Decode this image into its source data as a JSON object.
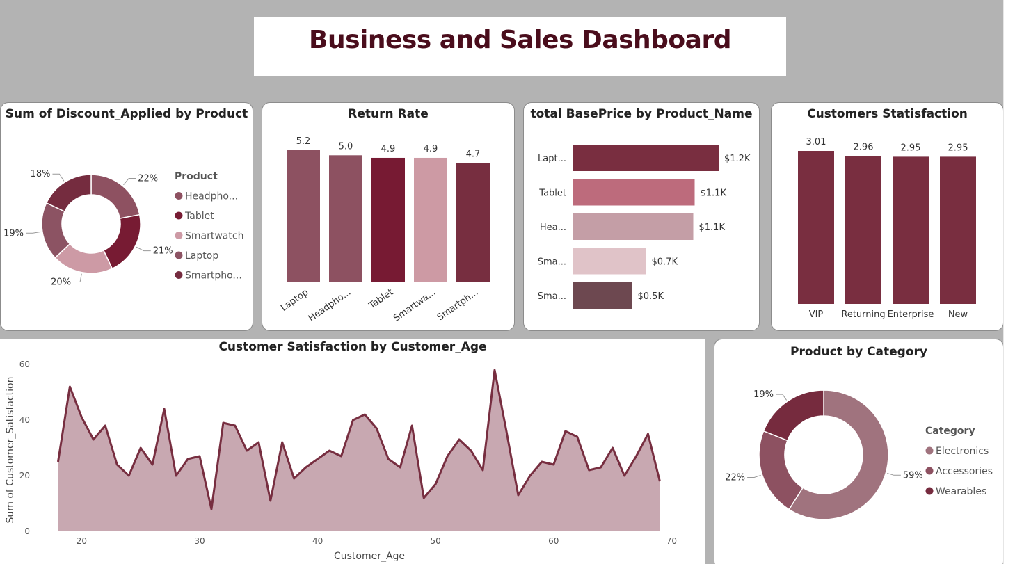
{
  "dashboard_title": "Business and Sales Dashboard",
  "chart_data": [
    {
      "id": "discount",
      "type": "pie",
      "title": "Sum of Discount_Applied by Product",
      "legend_title": "Product",
      "legend_position": "right",
      "slices": [
        {
          "label": "Headpho...",
          "pct_label": "22%",
          "value": 22,
          "color": "#8e5161"
        },
        {
          "label": "Tablet",
          "pct_label": "21%",
          "value": 21,
          "color": "#771b33"
        },
        {
          "label": "Smartwatch",
          "pct_label": "20%",
          "value": 20,
          "color": "#cd9aa5"
        },
        {
          "label": "Laptop",
          "pct_label": "19%",
          "value": 19,
          "color": "#8c5363"
        },
        {
          "label": "Smartpho...",
          "pct_label": "18%",
          "value": 18,
          "color": "#752c3f"
        }
      ]
    },
    {
      "id": "return_rate",
      "type": "bar",
      "title": "Return Rate",
      "categories": [
        "Laptop",
        "Headpho...",
        "Tablet",
        "Smartwa...",
        "Smartph..."
      ],
      "values": [
        5.2,
        5.0,
        4.9,
        4.9,
        4.7
      ],
      "value_labels": [
        "5.2",
        "5.0",
        "4.9",
        "4.9",
        "4.7"
      ],
      "colors": [
        "#8d5161",
        "#8d5161",
        "#771a33",
        "#cd9aa4",
        "#772e40"
      ],
      "ylim": [
        0,
        5.2
      ]
    },
    {
      "id": "baseprice",
      "type": "bar",
      "orientation": "horizontal",
      "title": "total BasePrice by Product_Name",
      "categories": [
        "Lapt...",
        "Tablet",
        "Hea...",
        "Sma...",
        "Sma..."
      ],
      "values": [
        1.2,
        1.1,
        1.1,
        0.7,
        0.5
      ],
      "value_labels": [
        "$1.2K",
        "$1.1K",
        "$1.1K",
        "$0.7K",
        "$0.5K"
      ],
      "colors": [
        "#792e40",
        "#bd6b7c",
        "#c49ea6",
        "#e0c3c8",
        "#6d4850"
      ]
    },
    {
      "id": "satisfaction",
      "type": "bar",
      "title": "Customers Statisfaction",
      "categories": [
        "VIP",
        "Returning",
        "Enterprise",
        "New"
      ],
      "values": [
        3.01,
        2.96,
        2.95,
        2.95
      ],
      "value_labels": [
        "3.01",
        "2.96",
        "2.95",
        "2.95"
      ],
      "color": "#792e40"
    },
    {
      "id": "age",
      "type": "area",
      "title": "Customer Satisfaction by Customer_Age",
      "xlabel": "Customer_Age",
      "ylabel": "Sum of Customer_Satisfaction",
      "xlim": [
        17,
        70
      ],
      "ylim": [
        0,
        60
      ],
      "xticks": [
        20,
        30,
        40,
        50,
        60,
        70
      ],
      "yticks": [
        0,
        20,
        40,
        60
      ],
      "line_color": "#772e40",
      "fill_color": "#c8a8b1",
      "x": [
        18,
        19,
        20,
        21,
        22,
        23,
        24,
        25,
        26,
        27,
        28,
        29,
        30,
        31,
        32,
        33,
        34,
        35,
        36,
        37,
        38,
        39,
        40,
        41,
        42,
        43,
        44,
        45,
        46,
        47,
        48,
        49,
        50,
        51,
        52,
        53,
        54,
        55,
        56,
        57,
        58,
        59,
        60,
        61,
        62,
        63,
        64,
        65,
        66,
        67,
        68,
        69
      ],
      "y": [
        25,
        52,
        41,
        33,
        38,
        24,
        20,
        30,
        24,
        44,
        20,
        26,
        27,
        8,
        39,
        38,
        29,
        32,
        11,
        32,
        19,
        23,
        26,
        29,
        27,
        40,
        42,
        37,
        26,
        23,
        38,
        12,
        17,
        27,
        33,
        29,
        22,
        58,
        36,
        13,
        20,
        25,
        24,
        36,
        34,
        22,
        23,
        30,
        20,
        27,
        35,
        18
      ]
    },
    {
      "id": "category",
      "type": "pie",
      "title": "Product by Category",
      "legend_title": "Category",
      "legend_position": "right",
      "slices": [
        {
          "label": "Electronics",
          "pct_label": "59%",
          "value": 59,
          "color": "#a0737e"
        },
        {
          "label": "Accessories",
          "pct_label": "22%",
          "value": 22,
          "color": "#8d5161"
        },
        {
          "label": "Wearables",
          "pct_label": "19%",
          "value": 19,
          "color": "#762b3e"
        }
      ]
    }
  ]
}
